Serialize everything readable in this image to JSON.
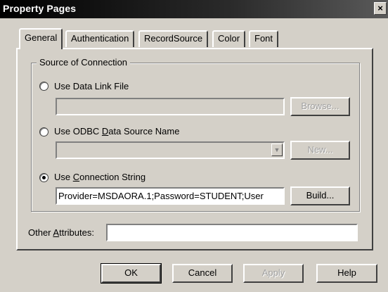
{
  "window": {
    "title": "Property Pages",
    "close_label": "×"
  },
  "tabs": [
    {
      "label": "General",
      "active": true
    },
    {
      "label": "Authentication",
      "active": false
    },
    {
      "label": "RecordSource",
      "active": false
    },
    {
      "label": "Color",
      "active": false
    },
    {
      "label": "Font",
      "active": false
    }
  ],
  "source": {
    "group_label": "Source of Connection",
    "data_link": {
      "label": "Use Data Link File",
      "value": "",
      "browse_label": "Browse...",
      "selected": false
    },
    "odbc": {
      "label_prefix": "Use ODBC ",
      "label_accel": "D",
      "label_suffix": "ata Source Name",
      "value": "",
      "new_label": "New...",
      "selected": false
    },
    "conn_string": {
      "label_prefix": "Use ",
      "label_accel": "C",
      "label_suffix": "onnection String",
      "value": "Provider=MSDAORA.1;Password=STUDENT;User",
      "build_label": "Build...",
      "selected": true
    }
  },
  "other_attributes": {
    "label_prefix": "Other ",
    "label_accel": "A",
    "label_suffix": "ttributes:",
    "value": ""
  },
  "buttons": {
    "ok": "OK",
    "cancel": "Cancel",
    "apply": "Apply",
    "help": "Help"
  }
}
